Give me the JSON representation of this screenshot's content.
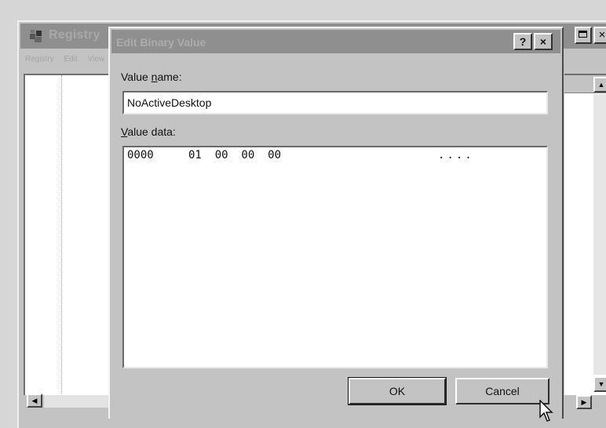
{
  "background_window": {
    "title": "Registry",
    "menu": [
      "Registry",
      "Edit",
      "View"
    ],
    "buttons": {
      "maximize": "maximize",
      "close": "×"
    }
  },
  "dialog": {
    "title": "Edit Binary Value",
    "help_button": "?",
    "close_button": "×",
    "value_name_label_pre": "Value ",
    "value_name_label_ul": "n",
    "value_name_label_post": "ame:",
    "value_name": "NoActiveDesktop",
    "value_data_label_ul": "V",
    "value_data_label_post": "alue data:",
    "value_data": {
      "offset": "0000",
      "bytes": "01  00  00  00",
      "ascii": "...."
    },
    "ok_label": "OK",
    "cancel_label": "Cancel"
  },
  "icons": [
    "registry-app-icon",
    "mouse-cursor-icon",
    "scroll-up-icon",
    "scroll-down-icon",
    "scroll-left-icon",
    "scroll-right-icon"
  ]
}
